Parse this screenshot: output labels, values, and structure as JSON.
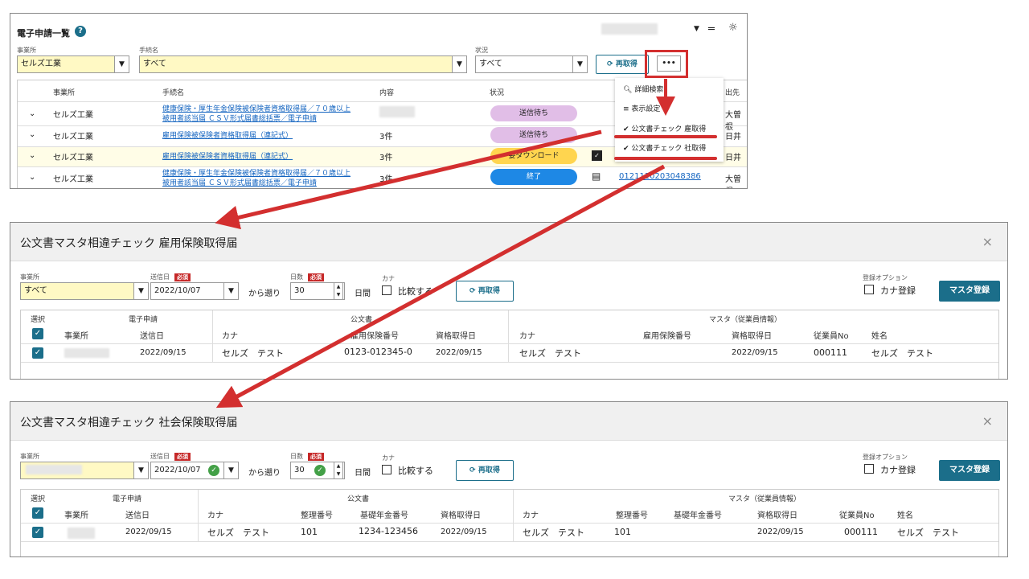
{
  "top": {
    "title": "電子申請一覧",
    "filter_labels": {
      "office": "事業所",
      "procedure": "手続名",
      "status": "状況"
    },
    "office_value": "セルズ工業",
    "procedure_value": "すべて",
    "status_value": "すべて",
    "refresh_label": "再取得",
    "more_label": "•••",
    "columns": [
      "事業所",
      "手続名",
      "内容",
      "状況"
    ],
    "col_edge": [
      "出先",
      "大曽根",
      "日井",
      "日井",
      "大曽根"
    ],
    "rows": [
      {
        "office": "セルズ工業",
        "proc1": "健康保険・厚生年金保険被保険者資格取得届／７０歳以上",
        "proc2": "被用者該当届 ＣＳＶ形式届書総括票／電子申請",
        "content": "",
        "status": "送信待ち"
      },
      {
        "office": "セルズ工業",
        "proc1": "雇用保険被保険者資格取得届（連記式）",
        "proc2": "",
        "content": "3件",
        "status": "送信待ち"
      },
      {
        "office": "セルズ工業",
        "proc1": "雇用保険被保険者資格取得届（連記式）",
        "proc2": "",
        "content": "3件",
        "status": "要ダウンロード"
      },
      {
        "office": "セルズ工業",
        "proc1": "健康保険・厚生年金保険被保険者資格取得届／７０歳以上",
        "proc2": "被用者該当届 ＣＳＶ形式届書総括票／電子申請",
        "content": "3件",
        "status": "終了",
        "number": "012111020304838 86"
      }
    ],
    "last_number": "0121110203048386",
    "menu": [
      "詳細検索",
      "表示設定",
      "公文書チェック 雇取得",
      "公文書チェック 社取得"
    ]
  },
  "dialog1": {
    "title": "公文書マスタ相違チェック 雇用保険取得届",
    "office_label": "事業所",
    "office_value": "すべて",
    "sent_date_label": "送信日",
    "required": "必須",
    "sent_date_value": "2022/10/07",
    "back_label": "から遡り",
    "days_label": "日数",
    "days_value": "30",
    "days_unit": "日間",
    "kana_label": "カナ",
    "compare_label": "比較する",
    "refresh_label": "再取得",
    "reg_option_label": "登録オプション",
    "kana_reg_label": "カナ登録",
    "master_reg_label": "マスタ登録",
    "groups": {
      "select": "選択",
      "e_app": "電子申請",
      "official": "公文書",
      "master": "マスタ（従業員情報）"
    },
    "headers": [
      "事業所",
      "送信日",
      "カナ",
      "雇用保険番号",
      "資格取得日",
      "カナ",
      "雇用保険番号",
      "資格取得日",
      "従業員No",
      "姓名"
    ],
    "row": {
      "sent": "2022/09/15",
      "kana": "セルズ　テスト",
      "ins_no": "0123-012345-0",
      "acq": "2022/09/15",
      "m_kana": "セルズ　テスト",
      "m_ins": "",
      "m_acq": "2022/09/15",
      "emp_no": "000111",
      "name": "セルズ　テスト"
    }
  },
  "dialog2": {
    "title": "公文書マスタ相違チェック 社会保険取得届",
    "office_label": "事業所",
    "office_value": "",
    "sent_date_label": "送信日",
    "required": "必須",
    "sent_date_value": "2022/10/07",
    "back_label": "から遡り",
    "days_label": "日数",
    "days_value": "30",
    "days_unit": "日間",
    "kana_label": "カナ",
    "compare_label": "比較する",
    "refresh_label": "再取得",
    "reg_option_label": "登録オプション",
    "kana_reg_label": "カナ登録",
    "master_reg_label": "マスタ登録",
    "groups": {
      "select": "選択",
      "e_app": "電子申請",
      "official": "公文書",
      "master": "マスタ（従業員情報）"
    },
    "headers": [
      "事業所",
      "送信日",
      "カナ",
      "整理番号",
      "基礎年金番号",
      "資格取得日",
      "カナ",
      "整理番号",
      "基礎年金番号",
      "資格取得日",
      "従業員No",
      "姓名"
    ],
    "row": {
      "sent": "2022/09/15",
      "kana": "セルズ　テスト",
      "ref_no": "101",
      "pension": "1234-123456",
      "acq": "2022/09/15",
      "m_kana": "セルズ　テスト",
      "m_ref": "101",
      "m_pension": "",
      "m_acq": "2022/09/15",
      "emp_no": "000111",
      "name": "セルズ　テスト"
    }
  },
  "colors": {
    "accent": "#1b6e8a",
    "highlight": "#d32f2f",
    "yellow": "#fff9c4"
  }
}
